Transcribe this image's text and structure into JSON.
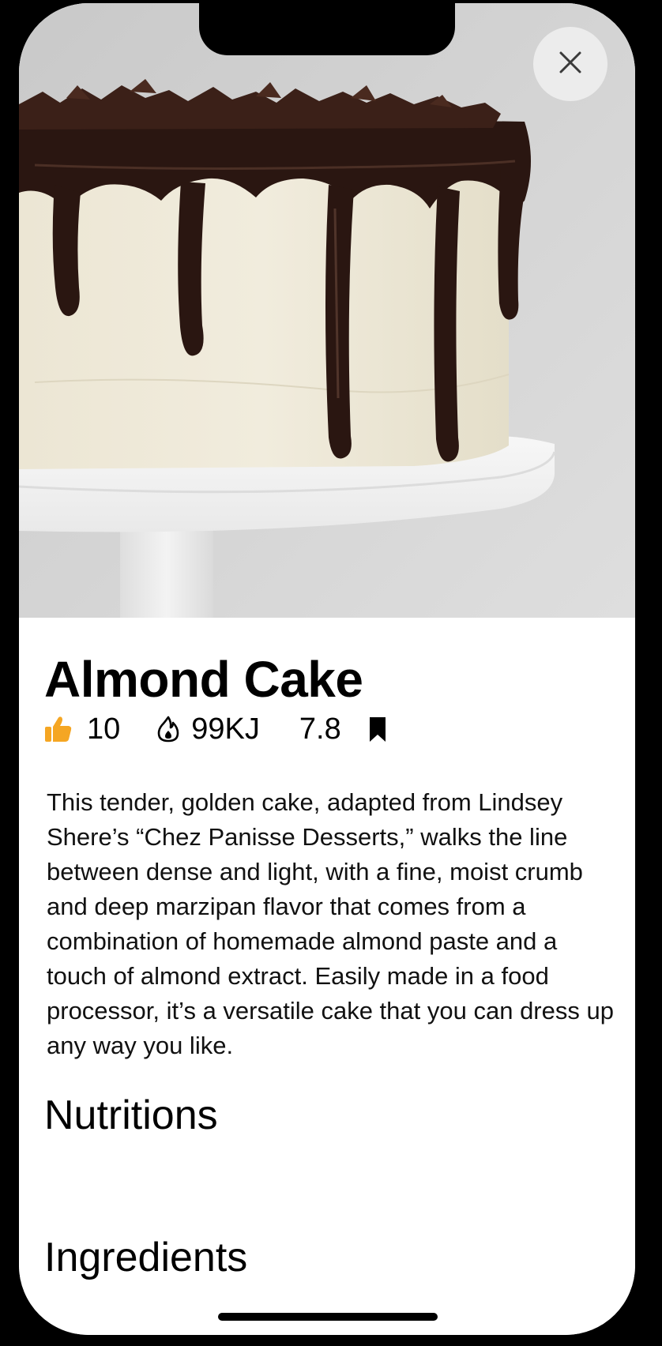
{
  "recipe": {
    "title": "Almond Cake",
    "likes": "10",
    "energy": "99KJ",
    "rating": "7.8",
    "description": "This tender, golden cake, adapted from Lindsey Shere’s “Chez Panisse Desserts,” walks the line between dense and light, with a fine, moist crumb and deep marzipan flavor that comes from a combination of homemade almond paste and a touch of almond extract. Easily made in a food processor, it’s a versatile cake that you can dress up any way you like."
  },
  "sections": {
    "nutritions": "Nutritions",
    "ingredients": "Ingredients"
  },
  "icons": {
    "close": "close-icon",
    "likes": "thumbs-up-icon",
    "energy": "flame-icon",
    "bookmark": "bookmark-icon"
  },
  "colors": {
    "accent": "#F5A623",
    "background": "#FFFFFF",
    "text": "#000000"
  }
}
